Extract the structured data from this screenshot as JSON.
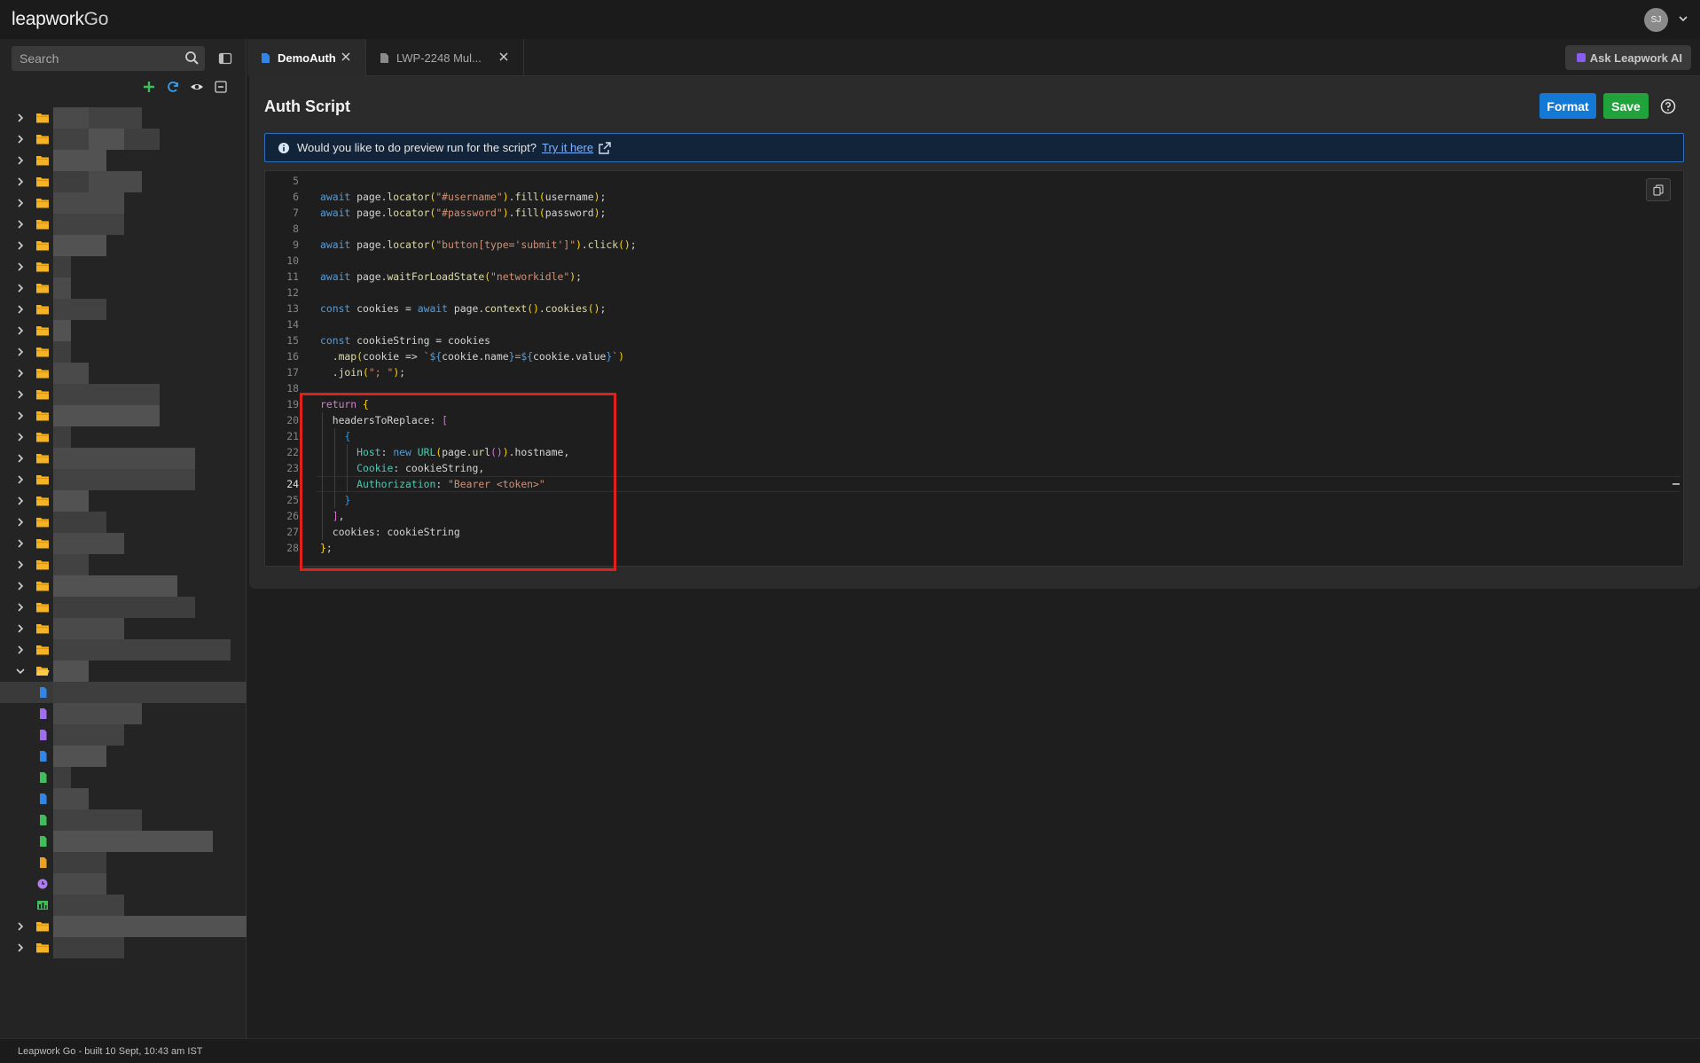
{
  "app": {
    "logo": "leapwork",
    "logo_suffix": "Go",
    "user_initials": "SJ"
  },
  "search": {
    "placeholder": "Search"
  },
  "tabs": [
    {
      "label": "DemoAuth",
      "active": true
    },
    {
      "label": "LWP-2248 Mul...",
      "active": false
    }
  ],
  "ask_ai": {
    "label": "Ask Leapwork AI"
  },
  "page": {
    "title": "Auth Script",
    "format_label": "Format",
    "save_label": "Save"
  },
  "info_bar": {
    "text": "Would you like to do preview run for the script?",
    "link": "Try it here"
  },
  "editor": {
    "current_line": 24,
    "lines": [
      {
        "n": "5",
        "tokens": []
      },
      {
        "n": "6",
        "tokens": [
          [
            "kw",
            "await"
          ],
          [
            "var",
            " page."
          ],
          [
            "fn",
            "locator"
          ],
          [
            "br1",
            "("
          ],
          [
            "str",
            "\"#username\""
          ],
          [
            "br1",
            ")"
          ],
          [
            "var",
            "."
          ],
          [
            "fn",
            "fill"
          ],
          [
            "br1",
            "("
          ],
          [
            "var",
            "username"
          ],
          [
            "br1",
            ")"
          ],
          [
            "var",
            ";"
          ]
        ]
      },
      {
        "n": "7",
        "tokens": [
          [
            "kw",
            "await"
          ],
          [
            "var",
            " page."
          ],
          [
            "fn",
            "locator"
          ],
          [
            "br1",
            "("
          ],
          [
            "str",
            "\"#password\""
          ],
          [
            "br1",
            ")"
          ],
          [
            "var",
            "."
          ],
          [
            "fn",
            "fill"
          ],
          [
            "br1",
            "("
          ],
          [
            "var",
            "password"
          ],
          [
            "br1",
            ")"
          ],
          [
            "var",
            ";"
          ]
        ]
      },
      {
        "n": "8",
        "tokens": []
      },
      {
        "n": "9",
        "tokens": [
          [
            "kw",
            "await"
          ],
          [
            "var",
            " page."
          ],
          [
            "fn",
            "locator"
          ],
          [
            "br1",
            "("
          ],
          [
            "str",
            "\"button[type='submit']\""
          ],
          [
            "br1",
            ")"
          ],
          [
            "var",
            "."
          ],
          [
            "fn",
            "click"
          ],
          [
            "br1",
            "()"
          ],
          [
            "var",
            ";"
          ]
        ]
      },
      {
        "n": "10",
        "tokens": []
      },
      {
        "n": "11",
        "tokens": [
          [
            "kw",
            "await"
          ],
          [
            "var",
            " page."
          ],
          [
            "fn",
            "waitForLoadState"
          ],
          [
            "br1",
            "("
          ],
          [
            "str",
            "\"networkidle\""
          ],
          [
            "br1",
            ")"
          ],
          [
            "var",
            ";"
          ]
        ]
      },
      {
        "n": "12",
        "tokens": []
      },
      {
        "n": "13",
        "tokens": [
          [
            "kw",
            "const"
          ],
          [
            "var",
            " cookies = "
          ],
          [
            "kw",
            "await"
          ],
          [
            "var",
            " page."
          ],
          [
            "fn",
            "context"
          ],
          [
            "br1",
            "()"
          ],
          [
            "var",
            "."
          ],
          [
            "fn",
            "cookies"
          ],
          [
            "br1",
            "()"
          ],
          [
            "var",
            ";"
          ]
        ]
      },
      {
        "n": "14",
        "tokens": []
      },
      {
        "n": "15",
        "tokens": [
          [
            "kw",
            "const"
          ],
          [
            "var",
            " cookieString = cookies"
          ]
        ]
      },
      {
        "n": "16",
        "tokens": [
          [
            "var",
            "  ."
          ],
          [
            "fn",
            "map"
          ],
          [
            "br1",
            "("
          ],
          [
            "var",
            "cookie => "
          ],
          [
            "tmpl",
            "`"
          ],
          [
            "kw",
            "${"
          ],
          [
            "var",
            "cookie.name"
          ],
          [
            "kw",
            "}"
          ],
          [
            "tmpl",
            "="
          ],
          [
            "kw",
            "${"
          ],
          [
            "var",
            "cookie.value"
          ],
          [
            "kw",
            "}"
          ],
          [
            "tmpl",
            "`"
          ],
          [
            "br1",
            ")"
          ]
        ]
      },
      {
        "n": "17",
        "tokens": [
          [
            "var",
            "  ."
          ],
          [
            "fn",
            "join"
          ],
          [
            "br1",
            "("
          ],
          [
            "str",
            "\"; \""
          ],
          [
            "br1",
            ")"
          ],
          [
            "var",
            ";"
          ]
        ]
      },
      {
        "n": "18",
        "tokens": []
      },
      {
        "n": "19",
        "tokens": [
          [
            "kwc",
            "return"
          ],
          [
            "var",
            " "
          ],
          [
            "br1",
            "{"
          ]
        ]
      },
      {
        "n": "20",
        "tokens": [
          [
            "var",
            "  headersToReplace: "
          ],
          [
            "br2",
            "["
          ]
        ]
      },
      {
        "n": "21",
        "tokens": [
          [
            "var",
            "    "
          ],
          [
            "br3",
            "{"
          ]
        ]
      },
      {
        "n": "22",
        "tokens": [
          [
            "var",
            "      "
          ],
          [
            "prop",
            "Host"
          ],
          [
            "var",
            ": "
          ],
          [
            "kw",
            "new"
          ],
          [
            "var",
            " "
          ],
          [
            "prop",
            "URL"
          ],
          [
            "br1",
            "("
          ],
          [
            "var",
            "page."
          ],
          [
            "fn",
            "url"
          ],
          [
            "br2",
            "()"
          ],
          [
            "br1",
            ")"
          ],
          [
            "var",
            ".hostname,"
          ]
        ]
      },
      {
        "n": "23",
        "tokens": [
          [
            "var",
            "      "
          ],
          [
            "prop",
            "Cookie"
          ],
          [
            "var",
            ": cookieString,"
          ]
        ]
      },
      {
        "n": "24",
        "tokens": [
          [
            "var",
            "      "
          ],
          [
            "prop",
            "Authorization"
          ],
          [
            "var",
            ": "
          ],
          [
            "str",
            "\"Bearer <token>\""
          ]
        ]
      },
      {
        "n": "25",
        "tokens": [
          [
            "var",
            "    "
          ],
          [
            "br3",
            "}"
          ]
        ]
      },
      {
        "n": "26",
        "tokens": [
          [
            "var",
            "  "
          ],
          [
            "br2",
            "]"
          ],
          [
            "var",
            ","
          ]
        ]
      },
      {
        "n": "27",
        "tokens": [
          [
            "var",
            "  cookies: cookieString"
          ]
        ]
      },
      {
        "n": "28",
        "tokens": [
          [
            "br1",
            "}"
          ],
          [
            "var",
            ";"
          ]
        ]
      }
    ]
  },
  "footer": {
    "text": "Leapwork Go - built 10 Sept, 10:43 am IST"
  },
  "tree": {
    "rows": [
      {
        "type": "folder",
        "expanded": false
      },
      {
        "type": "folder",
        "expanded": false
      },
      {
        "type": "folder",
        "expanded": false
      },
      {
        "type": "folder",
        "expanded": false
      },
      {
        "type": "folder",
        "expanded": false
      },
      {
        "type": "folder",
        "expanded": false
      },
      {
        "type": "folder",
        "expanded": false
      },
      {
        "type": "folder",
        "expanded": false
      },
      {
        "type": "folder",
        "expanded": false
      },
      {
        "type": "folder",
        "expanded": false
      },
      {
        "type": "folder",
        "expanded": false
      },
      {
        "type": "folder",
        "expanded": false
      },
      {
        "type": "folder",
        "expanded": false
      },
      {
        "type": "folder",
        "expanded": false
      },
      {
        "type": "folder",
        "expanded": false
      },
      {
        "type": "folder",
        "expanded": false
      },
      {
        "type": "folder",
        "expanded": false
      },
      {
        "type": "folder",
        "expanded": false
      },
      {
        "type": "folder",
        "expanded": false
      },
      {
        "type": "folder",
        "expanded": false
      },
      {
        "type": "folder",
        "expanded": false
      },
      {
        "type": "folder",
        "expanded": false
      },
      {
        "type": "folder",
        "expanded": false
      },
      {
        "type": "folder",
        "expanded": false
      },
      {
        "type": "folder",
        "expanded": false
      },
      {
        "type": "folder",
        "expanded": false
      },
      {
        "type": "folder",
        "expanded": true
      },
      {
        "type": "file",
        "color": "#2f86e8",
        "selected": true
      },
      {
        "type": "file",
        "color": "#a06cf0"
      },
      {
        "type": "file",
        "color": "#a06cf0"
      },
      {
        "type": "file",
        "color": "#2f86e8"
      },
      {
        "type": "file",
        "color": "#3fbf5a"
      },
      {
        "type": "file",
        "color": "#2f86e8"
      },
      {
        "type": "file",
        "color": "#3fbf5a"
      },
      {
        "type": "file",
        "color": "#3fbf5a"
      },
      {
        "type": "file",
        "color": "#f0a020"
      },
      {
        "type": "clock",
        "color": "#b07cf0"
      },
      {
        "type": "chart",
        "color": "#3fbf5a"
      },
      {
        "type": "folder",
        "expanded": false
      },
      {
        "type": "folder",
        "expanded": false
      }
    ]
  },
  "colors": {
    "accent_blue": "#1479d4",
    "save_green": "#1fa33a",
    "folder": "#f5b324",
    "highlight_red": "#e0201c"
  }
}
